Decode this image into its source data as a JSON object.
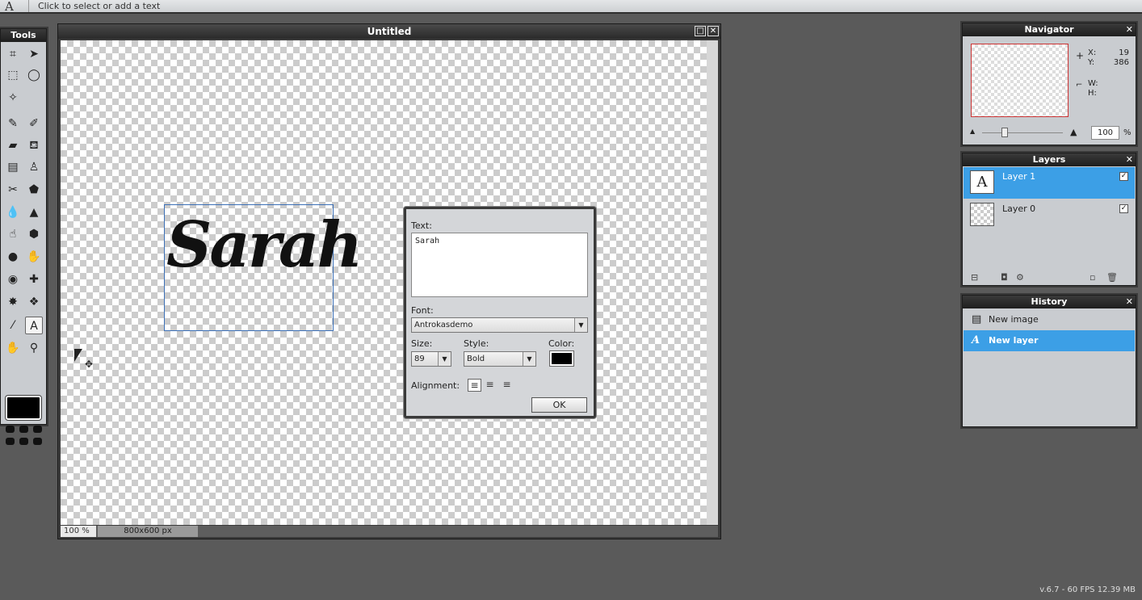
{
  "topbar": {
    "tool_icon": "A",
    "hint": "Click to select or add a text"
  },
  "tools": {
    "title": "Tools",
    "items": [
      {
        "name": "crop-tool-icon",
        "glyph": "⌗"
      },
      {
        "name": "move-tool-icon",
        "glyph": "➤"
      },
      {
        "name": "marquee-tool-icon",
        "glyph": "⬚"
      },
      {
        "name": "lasso-tool-icon",
        "glyph": "◯"
      },
      {
        "name": "magic-wand-tool-icon",
        "glyph": "✧"
      },
      {
        "name": "pencil-tool-icon",
        "glyph": "✎"
      },
      {
        "name": "brush-tool-icon",
        "glyph": "✐"
      },
      {
        "name": "eraser-tool-icon",
        "glyph": "▰"
      },
      {
        "name": "paint-bucket-tool-icon",
        "glyph": "⛾"
      },
      {
        "name": "gradient-tool-icon",
        "glyph": "▤"
      },
      {
        "name": "clone-stamp-tool-icon",
        "glyph": "♙"
      },
      {
        "name": "color-replace-tool-icon",
        "glyph": "✂"
      },
      {
        "name": "shape-tool-icon",
        "glyph": "⬟"
      },
      {
        "name": "blur-tool-icon",
        "glyph": "💧"
      },
      {
        "name": "sharpen-tool-icon",
        "glyph": "▲"
      },
      {
        "name": "smudge-tool-icon",
        "glyph": "☝"
      },
      {
        "name": "sponge-tool-icon",
        "glyph": "⬢"
      },
      {
        "name": "burn-tool-icon",
        "glyph": "●"
      },
      {
        "name": "dodge-tool-icon",
        "glyph": "✋"
      },
      {
        "name": "red-eye-tool-icon",
        "glyph": "◉"
      },
      {
        "name": "spot-heal-tool-icon",
        "glyph": "✚"
      },
      {
        "name": "bloat-tool-icon",
        "glyph": "✸"
      },
      {
        "name": "pinch-tool-icon",
        "glyph": "❖"
      },
      {
        "name": "color-picker-tool-icon",
        "glyph": "⁄"
      },
      {
        "name": "type-tool-icon",
        "glyph": "A",
        "selected": true
      },
      {
        "name": "hand-tool-icon",
        "glyph": "✋"
      },
      {
        "name": "zoom-tool-icon",
        "glyph": "⚲"
      }
    ],
    "foreground_color": "#000000"
  },
  "document": {
    "title": "Untitled",
    "zoom": "100 %",
    "size": "800x600 px",
    "text_content": "Sarah"
  },
  "text_dialog": {
    "text_label": "Text:",
    "text_value": "Sarah",
    "font_label": "Font:",
    "font_value": "Antrokasdemo",
    "size_label": "Size:",
    "size_value": "89",
    "style_label": "Style:",
    "style_value": "Bold",
    "color_label": "Color:",
    "color_value": "#000000",
    "alignment_label": "Alignment:",
    "ok_label": "OK"
  },
  "navigator": {
    "title": "Navigator",
    "x_label": "X:",
    "x_value": "19",
    "y_label": "Y:",
    "y_value": "386",
    "w_label": "W:",
    "h_label": "H:",
    "zoom_value": "100",
    "zoom_unit": "%"
  },
  "layers": {
    "title": "Layers",
    "items": [
      {
        "name": "Layer 1",
        "selected": true,
        "visible": true,
        "thumb": "A"
      },
      {
        "name": "Layer 0",
        "selected": false,
        "visible": true,
        "thumb": ""
      }
    ]
  },
  "history": {
    "title": "History",
    "items": [
      {
        "name": "New image",
        "selected": false
      },
      {
        "name": "New layer",
        "selected": true
      }
    ]
  },
  "version": "v.6.7 - 60 FPS 12.39 MB",
  "colors": {
    "selection_blue": "#3c9fe6",
    "background": "#5a5a5a"
  }
}
